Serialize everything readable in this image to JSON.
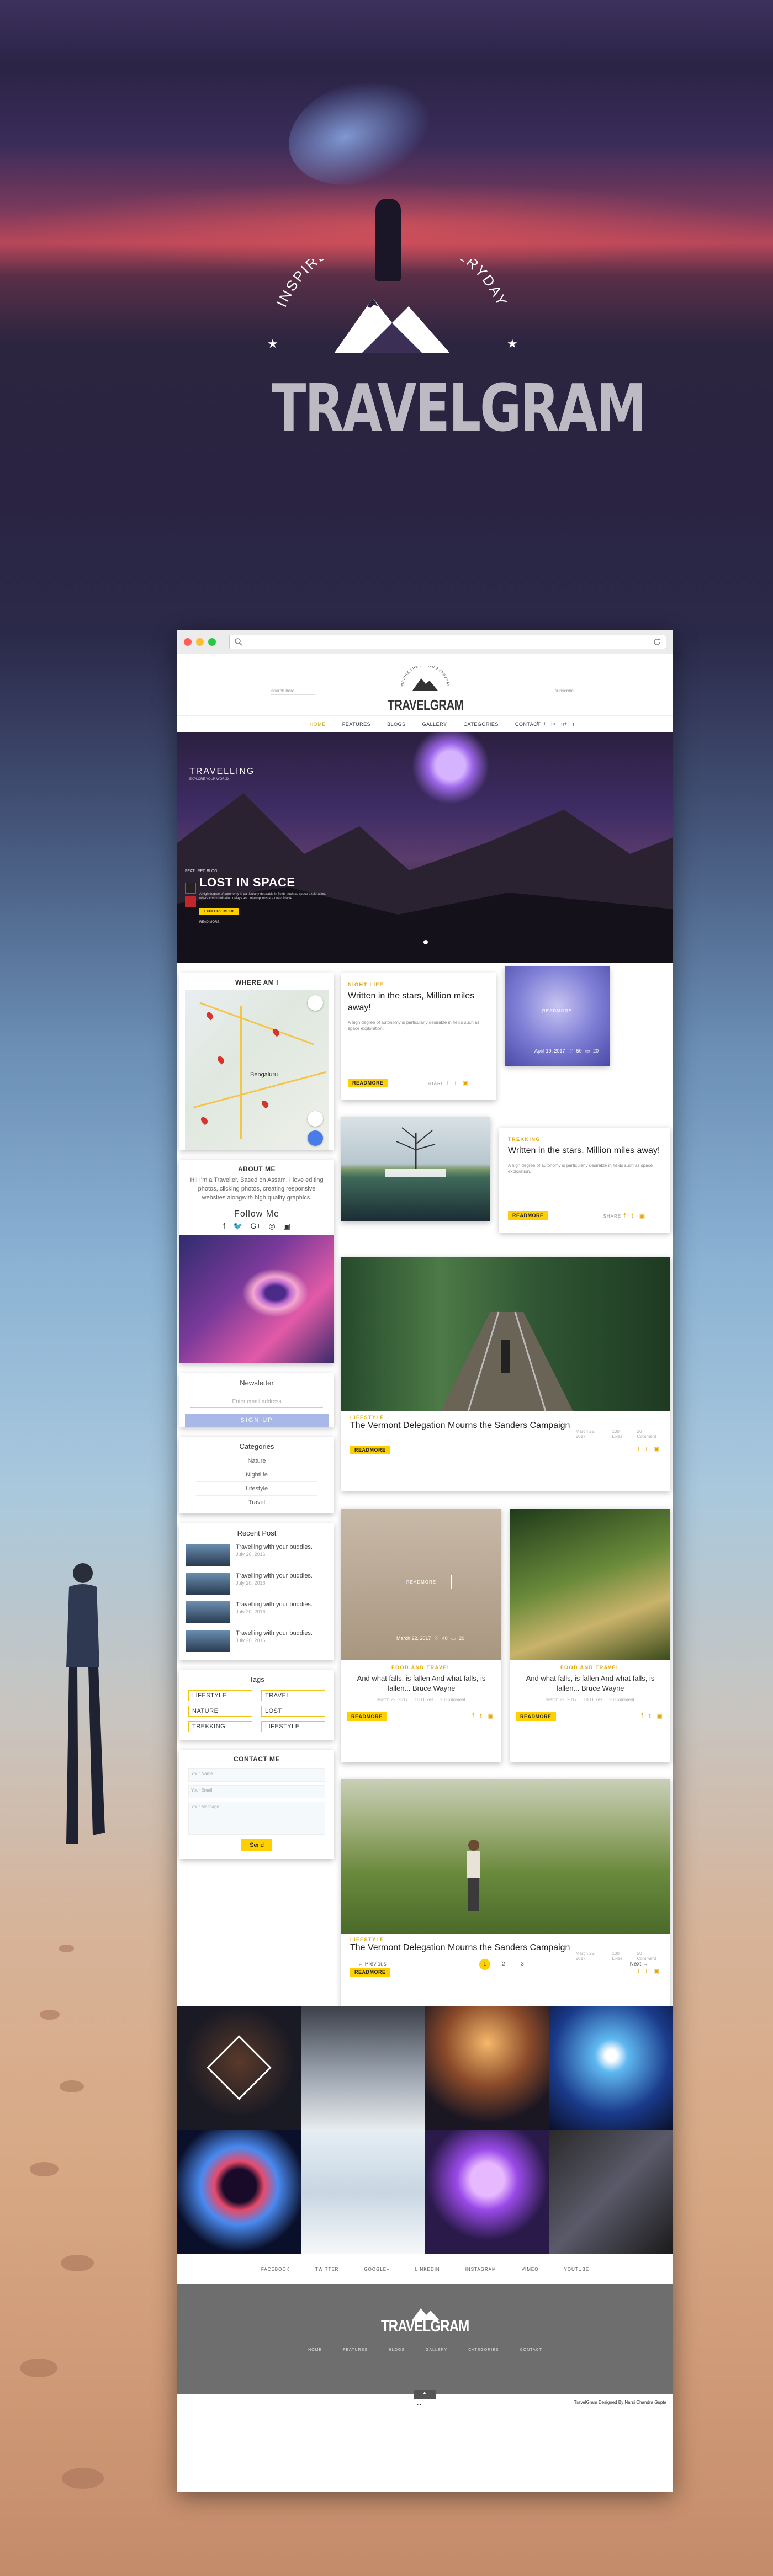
{
  "promo": {
    "arc_text": "INSPIRE THE WORLD EVERYDAY",
    "brand": "TRAVELGRAM"
  },
  "browser": {
    "dots": [
      "#ff5f57",
      "#ffbd2e",
      "#28c840"
    ]
  },
  "header": {
    "search_placeholder": "search here ...",
    "subscribe": "subscribe",
    "logo_arc": "INSPIRE THE WORLD EVERYDAY",
    "logo_name": "TRAVELGRAM"
  },
  "nav": {
    "items": [
      "HOME",
      "FEATURES",
      "BLOGS",
      "GALLERY",
      "CATEGORIES",
      "CONTACT"
    ],
    "active": "HOME",
    "social": [
      "f",
      "t",
      "in",
      "g+",
      "p"
    ]
  },
  "slider": {
    "brand": "TRAVELLING",
    "brand_sub": "EXPLORE YOUR WORLD",
    "featured_label": "FEATURED BLOG",
    "title": "LOST IN SPACE",
    "desc": "A high degree of autonomy is particularly desirable in fields such as space exploration, where communication delays and interruptions are unavoidable.",
    "button": "EXPLORE MORE",
    "more": "READ MORE"
  },
  "sidebar": {
    "where": {
      "title": "WHERE AM I",
      "city": "Bengaluru"
    },
    "about": {
      "title": "ABOUT ME",
      "text": "Hi! I'm a Traveller. Based on Assam. I love editing photos, clicking photos, creating responsive websites alongwith high quality graphics.",
      "follow": "Follow Me",
      "icons": [
        "f",
        "🐦",
        "G+",
        "◎",
        "▣"
      ]
    },
    "newsletter": {
      "title": "Newsletter",
      "placeholder": "Enter email address",
      "button": "SIGN UP"
    },
    "categories": {
      "title": "Categories",
      "items": [
        "Nature",
        "Nightlife",
        "Lifestyle",
        "Travel"
      ]
    },
    "recent": {
      "title": "Recent Post",
      "items": [
        {
          "text": "Travelling with your buddies.",
          "date": "July 20, 2016"
        },
        {
          "text": "Travelling with your buddies.",
          "date": "July 20, 2016"
        },
        {
          "text": "Travelling with your buddies.",
          "date": "July 20, 2016"
        },
        {
          "text": "Travelling with your buddies.",
          "date": "July 20, 2016"
        }
      ]
    },
    "tags": {
      "title": "Tags",
      "items": [
        "LIFESTYLE",
        "TRAVEL",
        "NATURE",
        "LOST",
        "TREKKING",
        "LIFESTYLE"
      ]
    },
    "contact": {
      "title": "CONTACT ME",
      "fields": [
        "Your Name",
        "Your Email",
        "Your Message"
      ],
      "button": "Send"
    }
  },
  "posts": {
    "p1": {
      "kicker": "NIGHT LIFE",
      "title": "Written in the stars, Million miles away!",
      "desc": "A high degree of autonomy is particularly desirable in fields such as space exploration.",
      "button": "READMORE",
      "share": "SHARE"
    },
    "p1img": {
      "overlay": "READMORE",
      "date": "April 19, 2017",
      "likes": "50",
      "comments": "20"
    },
    "p2": {
      "kicker": "TREKKING",
      "title": "Written in the stars, Million miles away!",
      "desc": "A high degree of autonomy is particularly desirable in fields such as space exploration.",
      "button": "READMORE",
      "share": "SHARE"
    },
    "p3": {
      "kicker": "LIFESTYLE",
      "title": "The Vermont Delegation Mourns the Sanders Campaign",
      "date": "March 22, 2017",
      "likes": "100 Likes",
      "comments": "20 Comment",
      "button": "READMORE"
    },
    "p4": {
      "overlay": "READMORE",
      "date": "March 22, 2017",
      "likes": "40",
      "comments": "20",
      "kicker": "FOOD AND TRAVEL",
      "quote": "And what falls, is fallen And what falls, is fallen... Bruce Wayne",
      "m_date": "March 22, 2017",
      "m_likes": "100 Likes",
      "m_comments": "20 Comment",
      "button": "READMORE"
    },
    "p5": {
      "kicker": "FOOD AND TRAVEL",
      "quote": "And what falls, is fallen And what falls, is fallen... Bruce Wayne",
      "m_date": "March 22, 2017",
      "m_likes": "100 Likes",
      "m_comments": "20 Comment",
      "button": "READMORE"
    },
    "p6": {
      "kicker": "LIFESTYLE",
      "title": "The Vermont Delegation Mourns the Sanders Campaign",
      "date": "March 22, 2017",
      "likes": "100 Likes",
      "comments": "20 Comment",
      "button": "READMORE"
    }
  },
  "pager": {
    "prev": "← Previous",
    "pages": [
      "1",
      "2",
      "3"
    ],
    "current": "1",
    "next": "Next →"
  },
  "footer": {
    "social": [
      "FACEBOOK",
      "TWITTER",
      "GOOGLE+",
      "LINKEDIN",
      "INSTAGRAM",
      "VIMEO",
      "YOUTUBE"
    ],
    "name": "TRAVELGRAM",
    "links": [
      "HOME",
      "FEATURES",
      "BLOGS",
      "GALLERY",
      "CATEGORIES",
      "CONTACT"
    ],
    "copyright": "TravelGram  Designed By Narsi Chandra Gupta",
    "top": "▲"
  }
}
